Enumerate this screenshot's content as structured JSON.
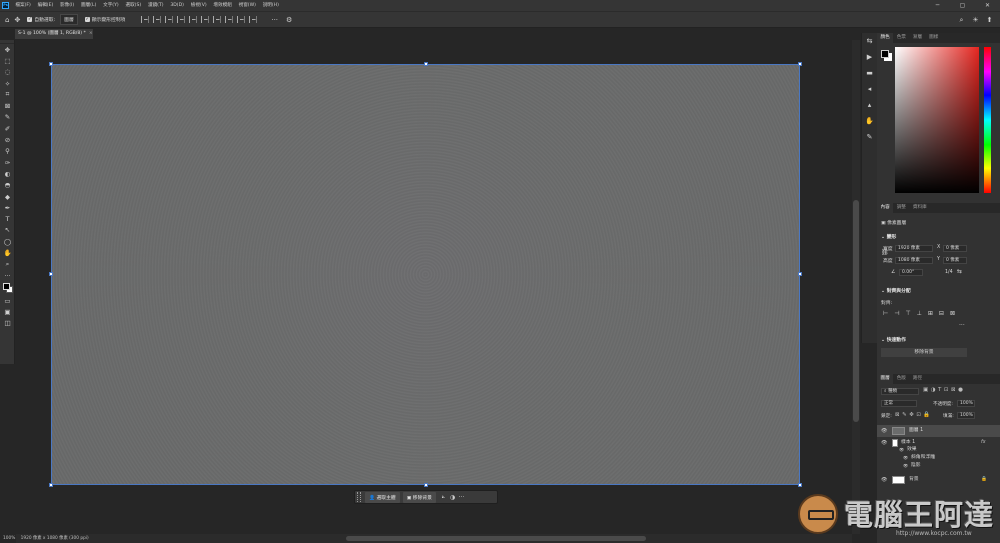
{
  "menubar": {
    "logo": "Ps",
    "items": [
      "檔案(F)",
      "編輯(E)",
      "影像(I)",
      "圖層(L)",
      "文字(Y)",
      "選取(S)",
      "濾鏡(T)",
      "3D(D)",
      "檢視(V)",
      "增效模組",
      "視窗(W)",
      "說明(H)"
    ],
    "minimize": "─",
    "maximize": "▢",
    "close": "✕"
  },
  "options": {
    "home": "⌂",
    "move": "✥",
    "auto_select_label": "自動選取:",
    "auto_select_value": "圖層",
    "transform_label": "顯示變形控制項",
    "more": "···",
    "gear": "⚙",
    "search": "⌕",
    "light": "☀",
    "share": "⬆"
  },
  "document": {
    "tab_title": "S-1 @ 100% (圖層 1, RGB/8) *",
    "close": "×"
  },
  "tools": [
    "✥",
    "⬚",
    "◌",
    "✧",
    "⌗",
    "⊠",
    "✎",
    "✐",
    "⊘",
    "⚲",
    "✑",
    "◐",
    "◓",
    "◆",
    "✒",
    "T",
    "↖",
    "◯",
    "✋",
    "⌕",
    "···"
  ],
  "contextual_taskbar": {
    "select_subject": "選取主體",
    "remove_background": "移除背景",
    "more": "···"
  },
  "status": {
    "zoom": "100%",
    "info": "1920 像素 x 1080 像素 (300 ppi)"
  },
  "color_panel": {
    "tabs": [
      "顏色",
      "色票",
      "漸層",
      "圖樣"
    ]
  },
  "properties_panel": {
    "tabs": [
      "內容",
      "調整",
      "資料庫"
    ],
    "pixel_layer": "像素圖層",
    "transform_title": "變形",
    "width_label": "寬度",
    "width_value": "1920 像素",
    "x_label": "X",
    "x_value": "0 像素",
    "height_label": "高度",
    "height_value": "1080 像素",
    "y_label": "Y",
    "y_value": "0 像素",
    "angle_value": "0.00°",
    "ratio": "1/4",
    "align_title": "對齊與分配",
    "align_label": "對齊:",
    "quick_actions_title": "快速動作",
    "remove_background_button": "移除背景"
  },
  "layers_panel": {
    "tabs": [
      "圖層",
      "色版",
      "路徑"
    ],
    "kind": "種類",
    "blend_mode": "正常",
    "opacity_label": "不透明度:",
    "opacity_value": "100%",
    "lock_label": "鎖定:",
    "fill_label": "填滿:",
    "fill_value": "100%",
    "layers": [
      {
        "name": "圖層 1"
      },
      {
        "name": "樣本 1"
      },
      {
        "name": "效果"
      },
      {
        "name": "斜角和浮雕"
      },
      {
        "name": "陰影"
      },
      {
        "name": "背景"
      }
    ],
    "fx": "fx"
  },
  "watermark": {
    "text": "電腦王阿達",
    "url": "http://www.kocpc.com.tw"
  },
  "colors": {
    "accent": "#4a78c4",
    "canvas": "#6b6c6c"
  }
}
